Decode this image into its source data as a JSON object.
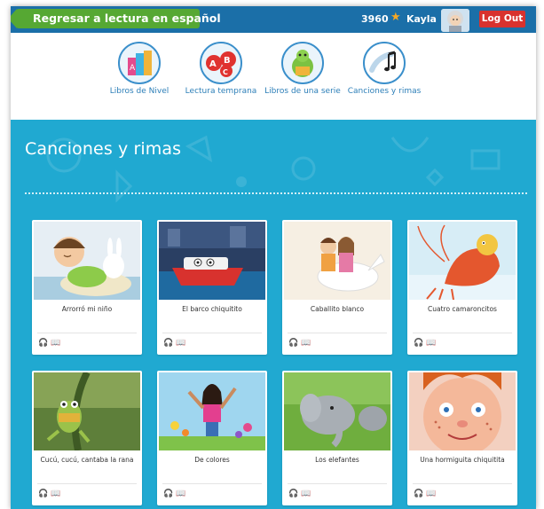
{
  "topbar": {
    "back_label": "Regresar a lectura en español",
    "stars": "3960",
    "star_symbol": "★",
    "username": "Kayla",
    "logout_label": "Log Out"
  },
  "categories": [
    {
      "label": "Libros de Nivel"
    },
    {
      "label": "Lectura temprana"
    },
    {
      "label": "Libros de una serie"
    },
    {
      "label": "Canciones y rimas"
    }
  ],
  "section": {
    "title": "Canciones y rimas"
  },
  "cards": [
    {
      "title": "Arrorró mi niño"
    },
    {
      "title": "El barco chiquitito"
    },
    {
      "title": "Caballito blanco"
    },
    {
      "title": "Cuatro camaroncitos"
    },
    {
      "title": "Cucú, cucú, cantaba la rana"
    },
    {
      "title": "De colores"
    },
    {
      "title": "Los elefantes"
    },
    {
      "title": "Una hormiguita chiquitita"
    }
  ],
  "card_icons": {
    "audio": "headphones-icon",
    "book": "book-icon"
  },
  "colors": {
    "topbar": "#1b6fa8",
    "back": "#56a833",
    "main": "#20a9d1",
    "logout": "#d8322e"
  }
}
